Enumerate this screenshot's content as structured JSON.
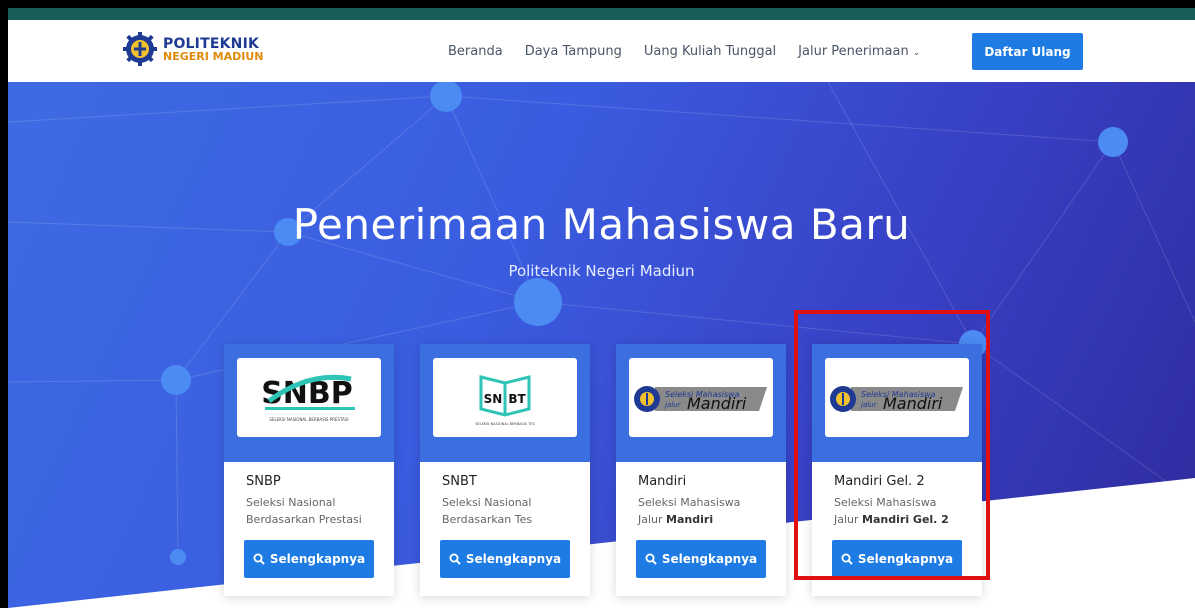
{
  "brand": {
    "line1": "POLITEKNIK",
    "line2": "NEGERI MADIUN"
  },
  "nav": [
    {
      "label": "Beranda"
    },
    {
      "label": "Daya Tampung"
    },
    {
      "label": "Uang Kuliah Tunggal"
    },
    {
      "label": "Jalur Penerimaan"
    }
  ],
  "nav_dropdown_chevron": "⌄",
  "cta": {
    "label": "Daftar Ulang"
  },
  "hero": {
    "title": "Penerimaan Mahasiswa Baru",
    "subtitle": "Politeknik Negeri Madiun"
  },
  "cards": [
    {
      "title": "SNBP",
      "desc_line1": "Seleksi Nasional",
      "desc_line2_prefix": "Berdasarkan Prestasi",
      "desc_line2_bold": "",
      "button": "Selengkapnya",
      "logo_text": "SNBP",
      "logo_caption": "SELEKSI NASIONAL BERBASIS PRESTASI"
    },
    {
      "title": "SNBT",
      "desc_line1": "Seleksi Nasional",
      "desc_line2_prefix": "Berdasarkan Tes",
      "desc_line2_bold": "",
      "button": "Selengkapnya",
      "logo_text_left": "SN",
      "logo_text_right": "BT",
      "logo_caption": "SELEKSI NASIONAL BERBASIS TES"
    },
    {
      "title": "Mandiri",
      "desc_line1": "Seleksi Mahasiswa",
      "desc_line2_prefix": "Jalur ",
      "desc_line2_bold": "Mandiri",
      "button": "Selengkapnya",
      "logo_small": "Seleksi Mahasiswa",
      "logo_small2": "jalur",
      "logo_big": "Mandiri"
    },
    {
      "title": "Mandiri Gel. 2",
      "desc_line1": "Seleksi Mahasiswa",
      "desc_line2_prefix": "Jalur ",
      "desc_line2_bold": "Mandiri Gel. 2",
      "button": "Selengkapnya",
      "logo_small": "Seleksi Mahasiswa",
      "logo_small2": "jalur",
      "logo_big": "Mandiri"
    }
  ],
  "colors": {
    "primary": "#1e7be3",
    "hero": "#3b5fe0",
    "highlight": "#e01010",
    "brand_blue": "#1f3a93",
    "brand_orange": "#e08a0a"
  },
  "icons": {
    "search": "search-icon",
    "logo": "polinema-gear-logo-icon"
  }
}
